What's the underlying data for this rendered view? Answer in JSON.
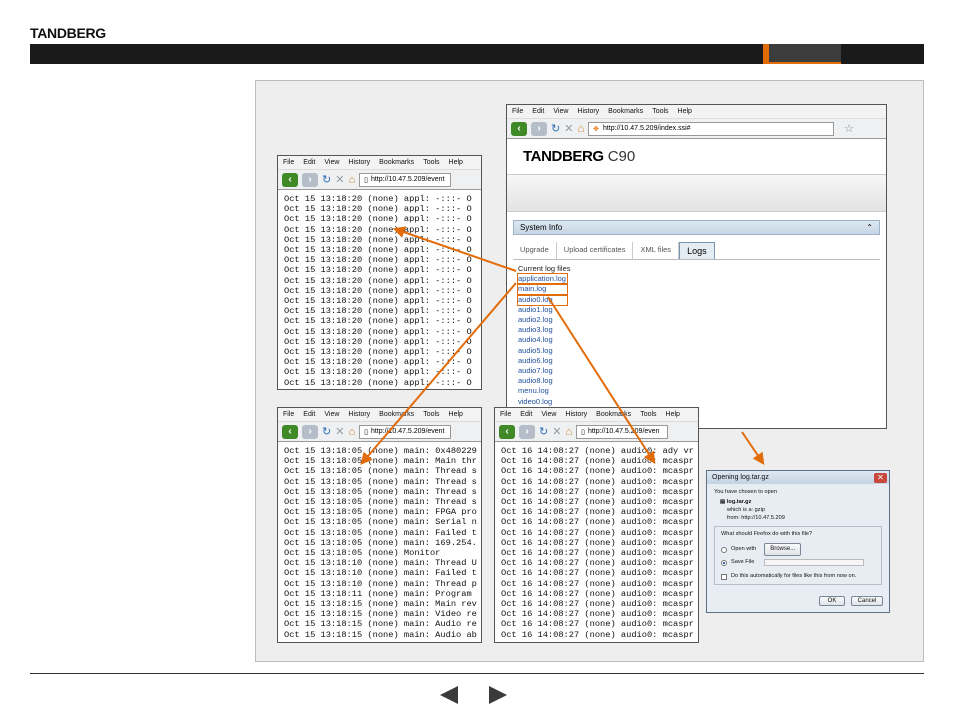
{
  "brand": "TANDBERG",
  "colors": {
    "accent": "#e36c0a",
    "link": "#1f4f9c",
    "topbar": "#1a1a1a"
  },
  "browser_menu": [
    "File",
    "Edit",
    "View",
    "History",
    "Bookmarks",
    "Tools",
    "Help"
  ],
  "main_window": {
    "url": "http://10.47.5.209/index.ssi#",
    "logo": "TANDBERG",
    "model": "C90",
    "section": "System Info",
    "tabs": [
      "Upgrade",
      "Upload certificates",
      "XML files",
      "Logs"
    ],
    "log_heading": "Current log files",
    "log_files": [
      "application.log",
      "main.log",
      "audio0.log",
      "audio1.log",
      "audio2.log",
      "audio3.log",
      "audio4.log",
      "audio5.log",
      "audio6.log",
      "audio7.log",
      "audio8.log",
      "menu.log",
      "video0.log",
      "video1.log"
    ]
  },
  "app_log_window": {
    "url": "http://10.47.5.209/event",
    "lines": "Oct 15 13:18:20 (none) appl: -:::- O\nOct 15 13:18:20 (none) appl: -:::- O\nOct 15 13:18:20 (none) appl: -:::- O\nOct 15 13:18:20 (none) appl: -:::- O\nOct 15 13:18:20 (none) appl: -:::- O\nOct 15 13:18:20 (none) appl: -:::- O\nOct 15 13:18:20 (none) appl: -:::- O\nOct 15 13:18:20 (none) appl: -:::- O\nOct 15 13:18:20 (none) appl: -:::- O\nOct 15 13:18:20 (none) appl: -:::- O\nOct 15 13:18:20 (none) appl: -:::- O\nOct 15 13:18:20 (none) appl: -:::- O\nOct 15 13:18:20 (none) appl: -:::- O\nOct 15 13:18:20 (none) appl: -:::- O\nOct 15 13:18:20 (none) appl: -:::- O\nOct 15 13:18:20 (none) appl: -:::- O\nOct 15 13:18:20 (none) appl: -:::- O\nOct 15 13:18:20 (none) appl: -:::- O\nOct 15 13:18:20 (none) appl: -:::- O"
  },
  "main_log_window": {
    "url": "http://10.47.5.209/event",
    "lines": "Oct 15 13:18:05 (none) main: 0x480229\nOct 15 13:18:05 (none) main: Main thr\nOct 15 13:18:05 (none) main: Thread s\nOct 15 13:18:05 (none) main: Thread s\nOct 15 13:18:05 (none) main: Thread s\nOct 15 13:18:05 (none) main: Thread s\nOct 15 13:18:05 (none) main: FPGA pro\nOct 15 13:18:05 (none) main: Serial n\nOct 15 13:18:05 (none) main: Failed t\nOct 15 13:18:05 (none) main: 169.254.\nOct 15 13:18:05 (none) Monitor\nOct 15 13:18:10 (none) main: Thread U\nOct 15 13:18:10 (none) main: Failed t\nOct 15 13:18:10 (none) main: Thread p\nOct 15 13:18:11 (none) main: Program\nOct 15 13:18:15 (none) main: Main rev\nOct 15 13:18:15 (none) main: Video re\nOct 15 13:18:15 (none) main: Audio re\nOct 15 13:18:15 (none) main: Audio ab"
  },
  "audio_log_window": {
    "url": "http://10.47.5.209/even",
    "lines": "Oct 16 14:08:27 (none) audio0: ady vr\nOct 16 14:08:27 (none) audio0: mcaspr\nOct 16 14:08:27 (none) audio0: mcaspr\nOct 16 14:08:27 (none) audio0: mcaspr\nOct 16 14:08:27 (none) audio0: mcaspr\nOct 16 14:08:27 (none) audio0: mcaspr\nOct 16 14:08:27 (none) audio0: mcaspr\nOct 16 14:08:27 (none) audio0: mcaspr\nOct 16 14:08:27 (none) audio0: mcaspr\nOct 16 14:08:27 (none) audio0: mcaspr\nOct 16 14:08:27 (none) audio0: mcaspr\nOct 16 14:08:27 (none) audio0: mcaspr\nOct 16 14:08:27 (none) audio0: mcaspr\nOct 16 14:08:27 (none) audio0: mcaspr\nOct 16 14:08:27 (none) audio0: mcaspr\nOct 16 14:08:27 (none) audio0: mcaspr\nOct 16 14:08:27 (none) audio0: mcaspr\nOct 16 14:08:27 (none) audio0: mcaspr\nOct 16 14:08:27 (none) audio0: mcaspr"
  },
  "dialog": {
    "title": "Opening log.tar.gz",
    "intro": "You have chosen to open",
    "filename": "log.tar.gz",
    "which_is": "which is a:  gzip",
    "from": "from:  http://10.47.5.209",
    "question": "What should Firefox do with this file?",
    "open_with": "Open with",
    "browse": "Browse...",
    "save_file": "Save File",
    "auto": "Do this automatically for files like this from now on.",
    "ok": "OK",
    "cancel": "Cancel"
  }
}
